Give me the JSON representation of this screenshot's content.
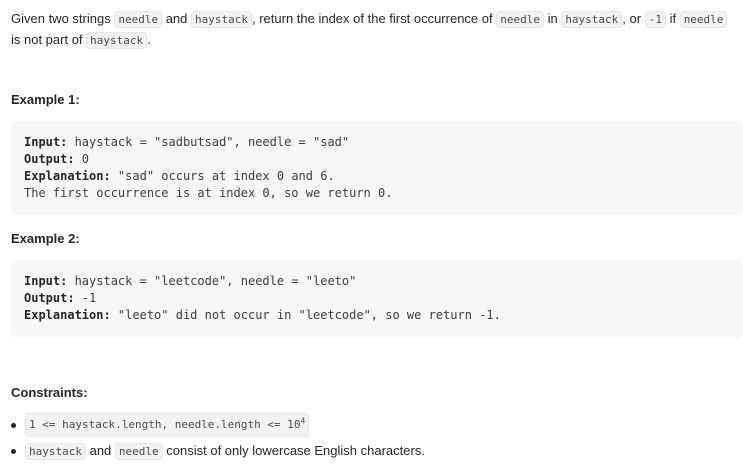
{
  "intro": {
    "t1": "Given two strings ",
    "c1": "needle",
    "t2": " and ",
    "c2": "haystack",
    "t3": ", return the index of the first occurrence of ",
    "c3": "needle",
    "t4": " in ",
    "c4": "haystack",
    "t5": ", or ",
    "c5": "-1",
    "t6": " if ",
    "c6": "needle",
    "t7": " is not part of ",
    "c7": "haystack",
    "t8": "."
  },
  "example1": {
    "heading": "Example 1:",
    "input_label": "Input:",
    "input_value": " haystack = \"sadbutsad\", needle = \"sad\"",
    "output_label": "Output:",
    "output_value": " 0",
    "explanation_label": "Explanation:",
    "explanation_value": " \"sad\" occurs at index 0 and 6.",
    "explanation_extra": "The first occurrence is at index 0, so we return 0."
  },
  "example2": {
    "heading": "Example 2:",
    "input_label": "Input:",
    "input_value": " haystack = \"leetcode\", needle = \"leeto\"",
    "output_label": "Output:",
    "output_value": " -1",
    "explanation_label": "Explanation:",
    "explanation_value": " \"leeto\" did not occur in \"leetcode\", so we return -1."
  },
  "constraints": {
    "heading": "Constraints:",
    "c1_code": "1 <= haystack.length, needle.length <= 10",
    "c1_sup": "4",
    "c2_code1": "haystack",
    "c2_t1": " and ",
    "c2_code2": "needle",
    "c2_t2": " consist of only lowercase English characters."
  }
}
